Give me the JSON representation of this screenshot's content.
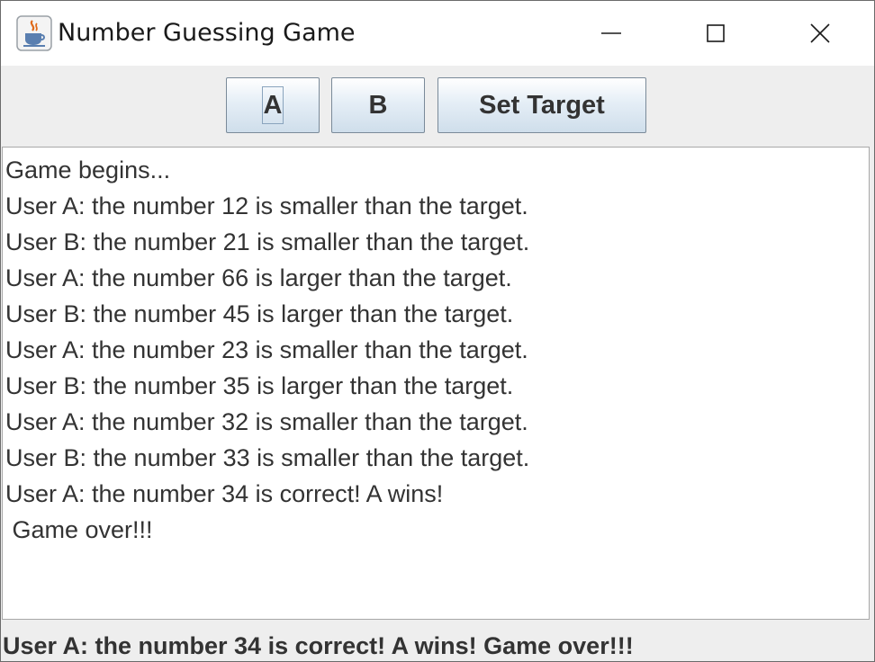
{
  "window": {
    "title": "Number Guessing Game",
    "app_icon": "java-coffee-cup-icon"
  },
  "toolbar": {
    "a_label": "A",
    "b_label": "B",
    "set_target_label": "Set Target"
  },
  "log": {
    "lines": [
      "Game begins...",
      "User A: the number 12 is smaller than the target.",
      "User B: the number 21 is smaller than the target.",
      "User A: the number 66 is larger than the target.",
      "User B: the number 45 is larger than the target.",
      "User A: the number 23 is smaller than the target.",
      "User B: the number 35 is larger than the target.",
      "User A: the number 32 is smaller than the target.",
      "User B: the number 33 is smaller than the target.",
      "User A: the number 34 is correct! A wins!",
      " Game over!!!"
    ]
  },
  "status": {
    "text": "User A: the number 34 is correct! A wins! Game over!!!"
  }
}
